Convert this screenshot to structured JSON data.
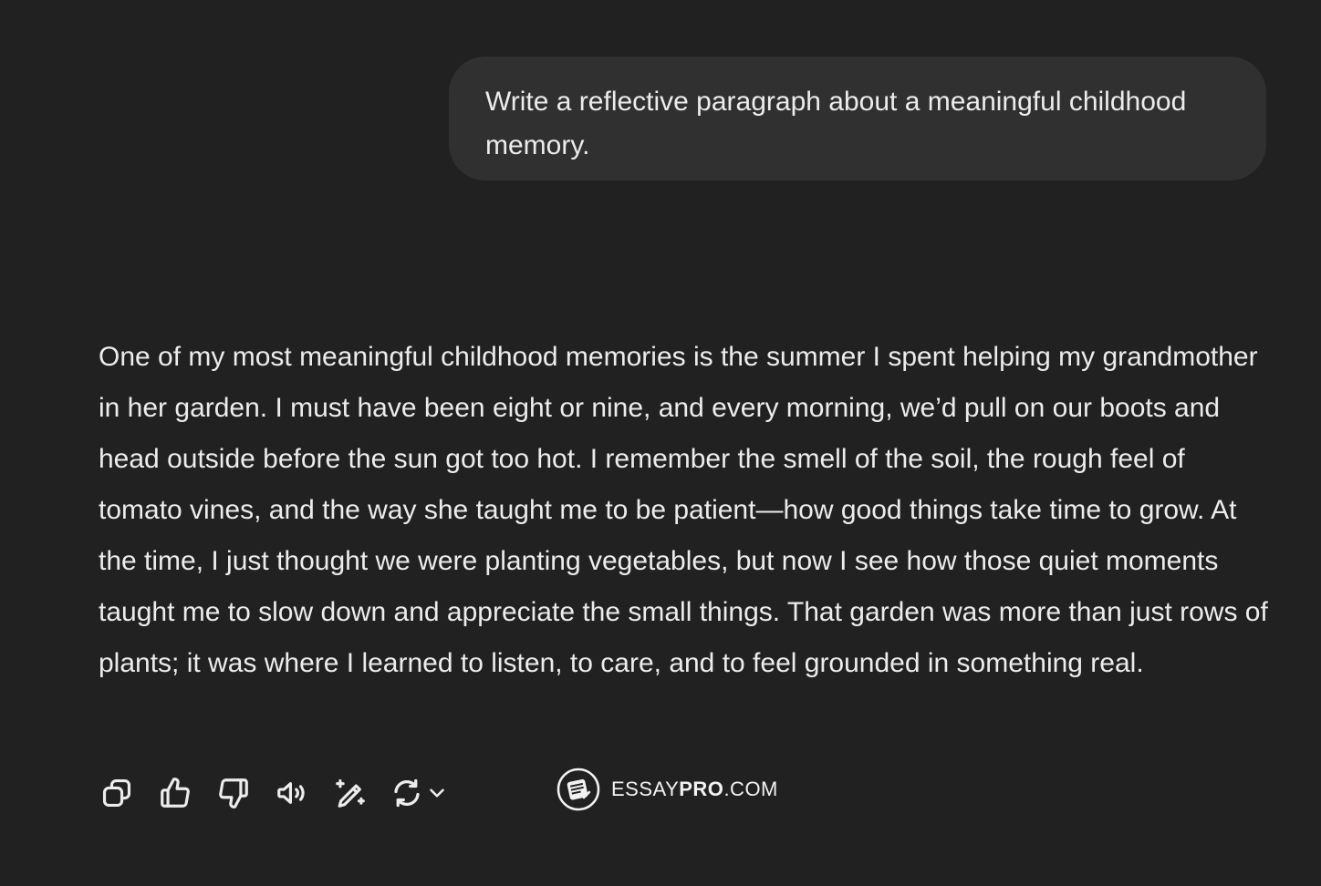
{
  "user_message": {
    "text": "Write a reflective paragraph about a meaningful childhood memory."
  },
  "assistant_message": {
    "text": "One of my most meaningful childhood memories is the summer I spent helping my grandmother in her garden. I must have been eight or nine, and every morning, we’d pull on our boots and head outside before the sun got too hot. I remember the smell of the soil, the rough feel of tomato vines, and the way she taught me to be patient—how good things take time to grow. At the time, I just thought we were planting vegetables, but now I see how those quiet moments taught me to slow down and appreciate the small things. That garden was more than just rows of plants; it was where I learned to listen, to care, and to feel grounded in something real."
  },
  "actions": [
    {
      "name": "copy",
      "icon": "copy-icon"
    },
    {
      "name": "thumbs-up",
      "icon": "thumbs-up-icon"
    },
    {
      "name": "thumbs-down",
      "icon": "thumbs-down-icon"
    },
    {
      "name": "read-aloud",
      "icon": "speaker-icon"
    },
    {
      "name": "edit",
      "icon": "magic-pencil-icon"
    },
    {
      "name": "regenerate",
      "icon": "refresh-icon"
    }
  ],
  "watermark": {
    "text_regular": "ESSAY",
    "text_bold": "PRO",
    "text_suffix": ".COM"
  },
  "colors": {
    "background": "#212121",
    "user_bubble": "#303030",
    "text": "#ececec"
  }
}
